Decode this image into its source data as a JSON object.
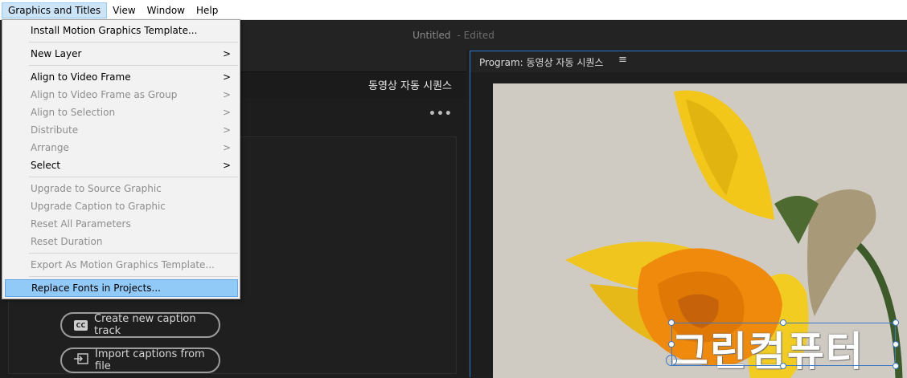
{
  "menubar": {
    "items": [
      "Graphics and Titles",
      "View",
      "Window",
      "Help"
    ],
    "active_index": 0
  },
  "titlebar": {
    "title": "Untitled",
    "edited": "- Edited"
  },
  "left_panel": {
    "sequence_title": "동영상 자동 시퀀스",
    "more_label": "•••",
    "buttons": {
      "create_caption": "Create new caption track",
      "import_captions": "Import captions from file",
      "cc_icon": "CC"
    }
  },
  "program_monitor": {
    "label": "Program: 동영상 자동 시퀀스",
    "menu_icon": "≡",
    "caption_text": "그린컴퓨터"
  },
  "dropdown": {
    "items": [
      {
        "label": "Install Motion Graphics Template...",
        "disabled": false,
        "submenu": false
      },
      {
        "label": "New Layer",
        "disabled": false,
        "submenu": true
      },
      {
        "label": "Align to Video Frame",
        "disabled": false,
        "submenu": true
      },
      {
        "label": "Align to Video Frame as Group",
        "disabled": true,
        "submenu": true
      },
      {
        "label": "Align to Selection",
        "disabled": true,
        "submenu": true
      },
      {
        "label": "Distribute",
        "disabled": true,
        "submenu": true
      },
      {
        "label": "Arrange",
        "disabled": true,
        "submenu": true
      },
      {
        "label": "Select",
        "disabled": false,
        "submenu": true
      },
      {
        "label": "Upgrade to Source Graphic",
        "disabled": true,
        "submenu": false
      },
      {
        "label": "Upgrade Caption to Graphic",
        "disabled": true,
        "submenu": false
      },
      {
        "label": "Reset All Parameters",
        "disabled": true,
        "submenu": false
      },
      {
        "label": "Reset Duration",
        "disabled": true,
        "submenu": false
      },
      {
        "label": "Export As Motion Graphics Template...",
        "disabled": true,
        "submenu": false
      },
      {
        "label": "Replace Fonts in Projects...",
        "disabled": false,
        "submenu": false,
        "highlighted": true
      }
    ],
    "submenu_arrow": ">"
  }
}
